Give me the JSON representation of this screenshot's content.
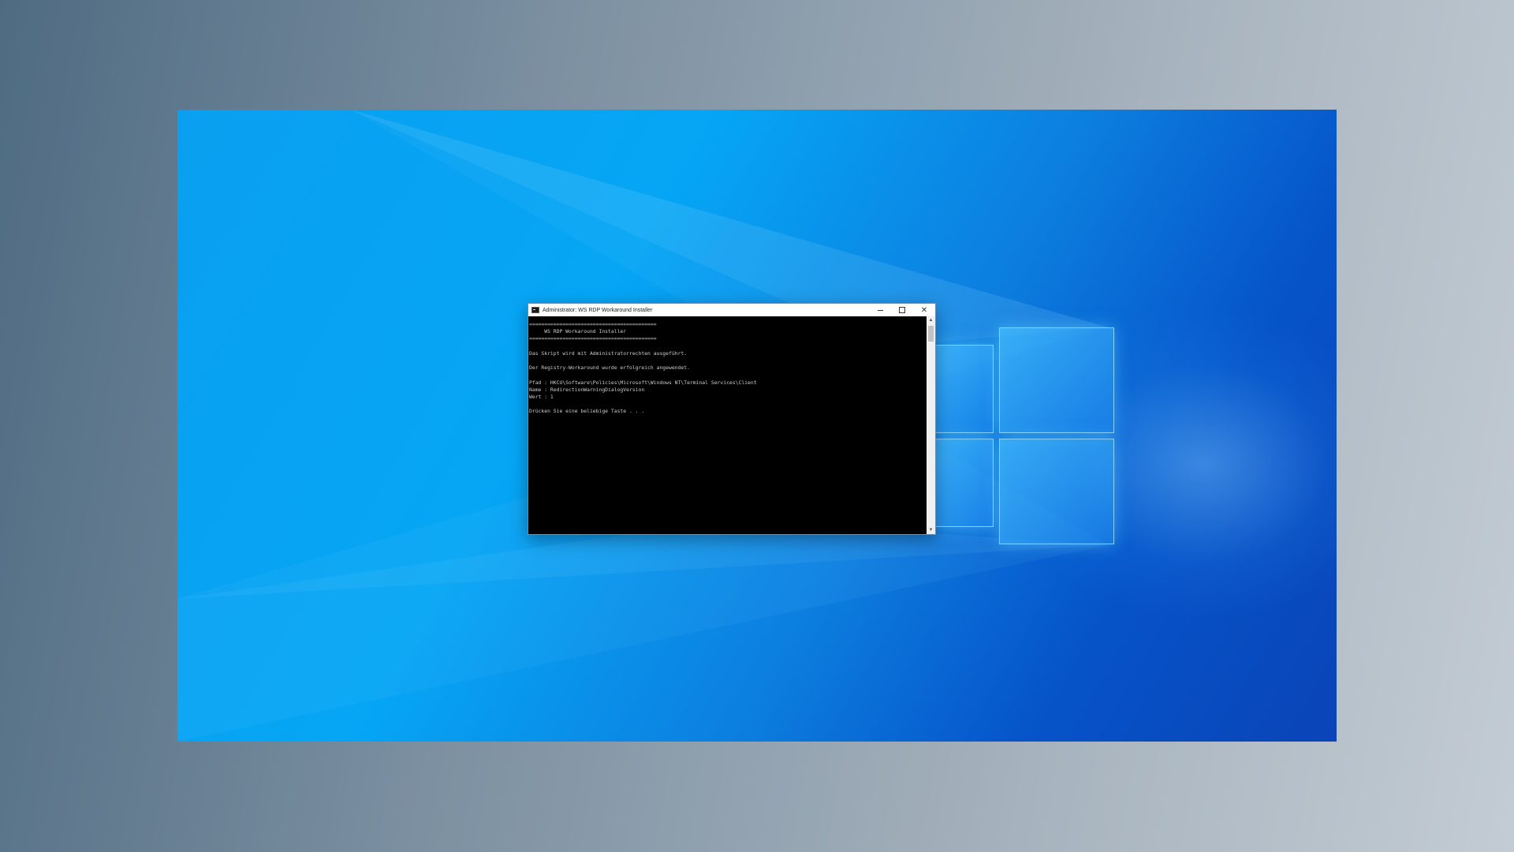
{
  "window": {
    "title": "Administrator:  WS RDP Workaround Installer",
    "minimize_icon": "minimize-icon",
    "maximize_icon": "maximize-icon",
    "close_icon": "close-icon",
    "close_glyph": "✕"
  },
  "console": {
    "lines": [
      "==========================================",
      "     WS RDP Workaround Installer",
      "==========================================",
      "",
      "Das Skript wird mit Administratorrechten ausgeführt.",
      "",
      "Der Registry-Workaround wurde erfolgreich angewendet.",
      "",
      "Pfad : HKCU\\Software\\Policies\\Microsoft\\Windows NT\\Terminal Services\\Client",
      "Name : RedirectionWarningDialogVersion",
      "Wert : 1",
      "",
      "Drücken Sie eine beliebige Taste . . ."
    ],
    "background": "#000000",
    "text_color": "#cccccc"
  },
  "scrollbar": {
    "up_glyph": "▲",
    "down_glyph": "▼"
  },
  "desktop": {
    "wallpaper": "windows-10-hero",
    "accent": "#0a7fe0"
  }
}
